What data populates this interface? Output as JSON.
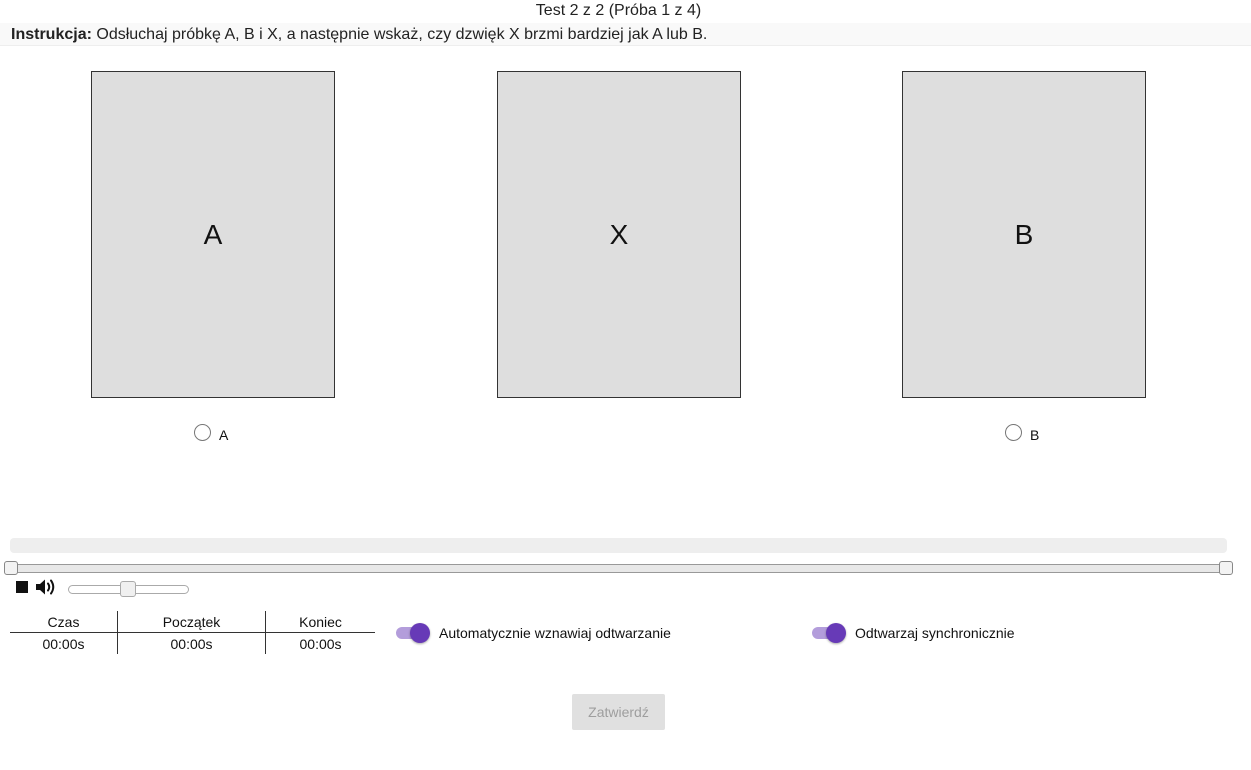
{
  "header": {
    "title": "Test 2 z 2 (Próba 1 z 4)",
    "instruction_label": "Instrukcja:",
    "instruction_text": " Odsłuchaj próbkę A, B i X, a następnie wskaż, czy dzwięk X brzmi bardziej jak A lub B."
  },
  "samples": [
    {
      "label": "A"
    },
    {
      "label": "X"
    },
    {
      "label": "B"
    }
  ],
  "choices": [
    {
      "label": "A",
      "selected": false
    },
    {
      "label": "B",
      "selected": false
    }
  ],
  "player": {
    "stop_icon": "stop-icon",
    "volume_icon": "volume-icon",
    "volume_level": 0.5
  },
  "times": {
    "headers": [
      "Czas",
      "Początek",
      "Koniec"
    ],
    "values": [
      "00:00s",
      "00:00s",
      "00:00s"
    ]
  },
  "toggles": [
    {
      "label": "Automatycznie wznawiaj odtwarzanie",
      "on": true
    },
    {
      "label": "Odtwarzaj synchronicznie",
      "on": true
    }
  ],
  "submit_label": "Zatwierdź",
  "colors": {
    "accent": "#673ab7",
    "accent_light": "#b39ddb",
    "card_bg": "#dedede"
  }
}
